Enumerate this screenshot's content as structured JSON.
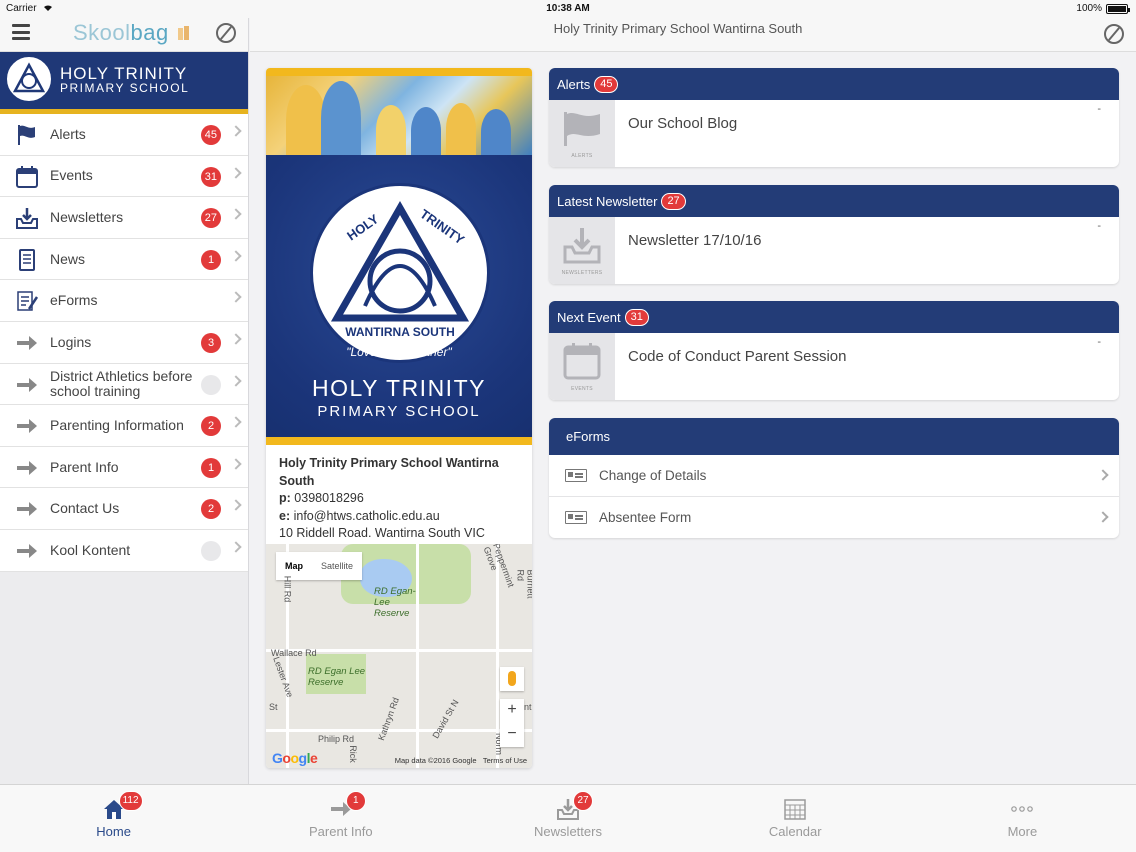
{
  "status_bar": {
    "carrier": "Carrier",
    "time": "10:38 AM",
    "battery": "100%"
  },
  "sidebar": {
    "brand_part1": "Skool",
    "brand_part2": "bag",
    "school_name_line1": "HOLY TRINITY",
    "school_name_line2": "PRIMARY SCHOOL",
    "items": [
      {
        "label": "Alerts",
        "count": "45",
        "icon": "flag-icon"
      },
      {
        "label": "Events",
        "count": "31",
        "icon": "calendar-icon"
      },
      {
        "label": "Newsletters",
        "count": "27",
        "icon": "download-tray-icon"
      },
      {
        "label": "News",
        "count": "1",
        "icon": "document-icon"
      },
      {
        "label": "eForms",
        "count": "",
        "icon": "form-icon"
      },
      {
        "label": "Logins",
        "count": "3",
        "icon": "arrow-right-icon"
      },
      {
        "label": "District Athletics before school training",
        "count": "",
        "icon": "arrow-right-icon"
      },
      {
        "label": "Parenting Information",
        "count": "2",
        "icon": "arrow-right-icon"
      },
      {
        "label": "Parent Info",
        "count": "1",
        "icon": "arrow-right-icon"
      },
      {
        "label": "Contact Us",
        "count": "2",
        "icon": "arrow-right-icon"
      },
      {
        "label": "Kool Kontent",
        "count": "",
        "icon": "arrow-right-icon"
      }
    ]
  },
  "header": {
    "title": "Holy Trinity Primary School Wantirna South"
  },
  "school_card": {
    "crest_text_left": "HOLY",
    "crest_text_right": "TRINITY",
    "crest_text_bottom": "WANTIRNA SOUTH",
    "crest_motto": "\"Love One Another\"",
    "name_line1": "HOLY TRINITY",
    "name_line2": "PRIMARY SCHOOL",
    "full_name": "Holy Trinity Primary School Wantirna South",
    "phone_label": "p:",
    "phone": "0398018296",
    "email_label": "e:",
    "email": "info@htws.catholic.edu.au",
    "address": "10 Riddell Road, Wantirna South VIC"
  },
  "map": {
    "tab_map": "Map",
    "tab_satellite": "Satellite",
    "labels": {
      "egan_lee_reserve": "RD Egan-Lee Reserve",
      "egan_lee_reserve_2": "RD Egan Lee Reserve",
      "wallace_rd": "Wallace Rd",
      "kathryn_rd": "Kathryn Rd",
      "david_st": "David St N",
      "philip_rd": "Philip Rd",
      "peppermint_grove": "Peppermint Grove",
      "burnett_rd": "Burnett Rd",
      "lester_ave": "Lester Ave",
      "hill_rd": "Hill Rd",
      "norm": "Norm",
      "rick": "Rick",
      "nt": "nt",
      "st": "St"
    },
    "zoom_in": "+",
    "zoom_out": "−",
    "google": "Google",
    "attribution": "Map data ©2016 Google",
    "terms": "Terms of Use"
  },
  "panels": {
    "alerts": {
      "title": "Alerts",
      "badge": "45",
      "item": "Our School Blog",
      "tile_label": "ALERTS",
      "dash": "-"
    },
    "newsletter": {
      "title": "Latest Newsletter",
      "badge": "27",
      "item": "Newsletter 17/10/16",
      "tile_label": "NEWSLETTERS",
      "dash": "-"
    },
    "event": {
      "title": "Next Event",
      "badge": "31",
      "item": "Code of Conduct Parent Session",
      "tile_label": "EVENTS",
      "dash": "-"
    },
    "eforms": {
      "title": "eForms",
      "items": [
        "Change of Details",
        "Absentee Form"
      ]
    }
  },
  "tabbar": [
    {
      "label": "Home",
      "badge": "112",
      "icon": "home-icon",
      "active": true
    },
    {
      "label": "Parent Info",
      "badge": "1",
      "icon": "arrow-right-icon",
      "active": false
    },
    {
      "label": "Newsletters",
      "badge": "27",
      "icon": "download-tray-icon",
      "active": false
    },
    {
      "label": "Calendar",
      "badge": "",
      "icon": "calendar-grid-icon",
      "active": false
    },
    {
      "label": "More",
      "badge": "",
      "icon": "more-icon",
      "active": false
    }
  ],
  "colors": {
    "navy": "#233c77",
    "gold": "#f2b81d",
    "badge_red": "#e23a3a"
  }
}
